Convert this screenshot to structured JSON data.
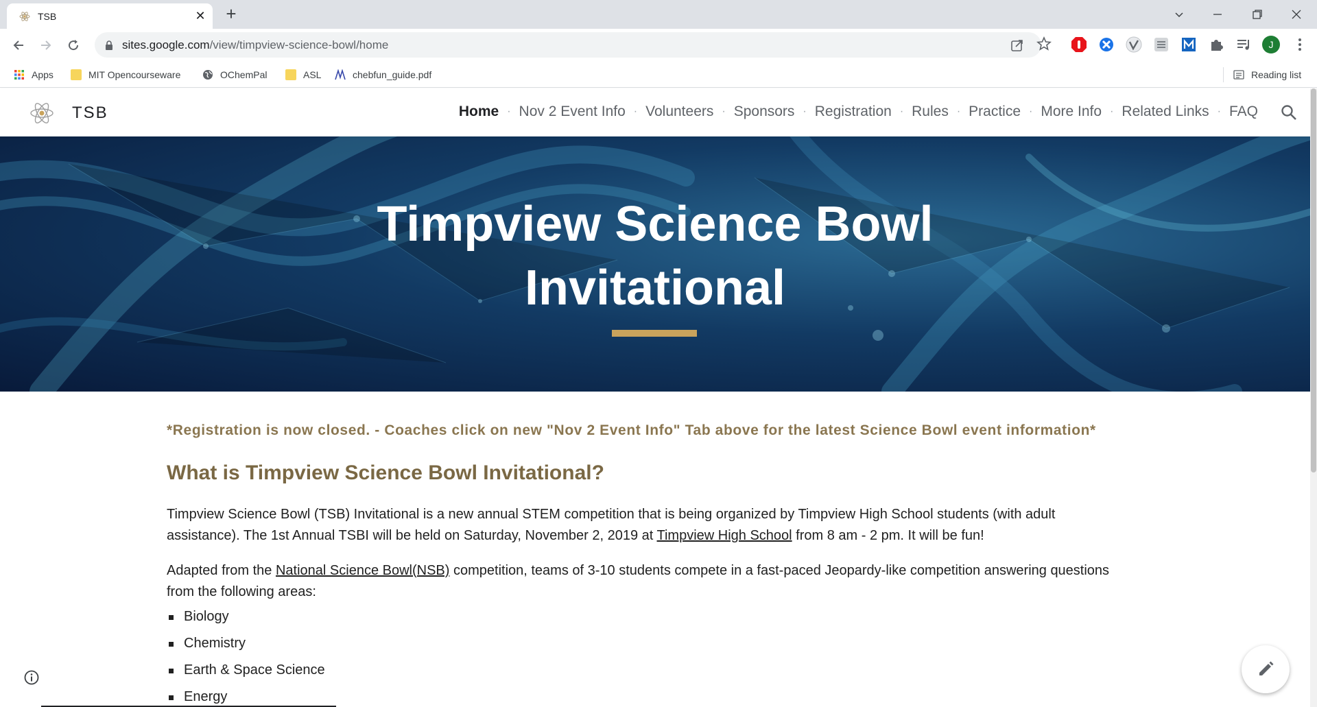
{
  "browser": {
    "tab_title": "TSB",
    "new_tab_symbol": "+",
    "close_symbol": "✕",
    "url_host": "sites.google.com",
    "url_path": "/view/timpview-science-bowl/home",
    "avatar_initial": "J",
    "reading_list_label": "Reading list",
    "bookmarks": [
      "Apps",
      "MIT Opencourseware",
      "OChemPal",
      "ASL",
      "chebfun_guide.pdf"
    ]
  },
  "site": {
    "name": "TSB",
    "nav": [
      "Home",
      "Nov 2 Event Info",
      "Volunteers",
      "Sponsors",
      "Registration",
      "Rules",
      "Practice",
      "More Info",
      "Related Links",
      "FAQ"
    ],
    "nav_separator": "·",
    "hero_title_line1": "Timpview Science Bowl",
    "hero_title_line2": "Invitational",
    "notice": "*Registration is now closed. - Coaches click on new \"Nov 2 Event Info\" Tab above for the latest Science Bowl event information*",
    "heading": "What is Timpview Science Bowl Invitational?",
    "p1_part1": "Timpview Science Bowl (TSB) Invitational is a new annual STEM competition that is being organized by Timpview High School students (with adult assistance). The 1st Annual TSBI will be held on Saturday, November 2, 2019 at ",
    "p1_link": "Timpview High School",
    "p1_part2": " from 8 am - 2 pm. It will be fun!",
    "p2_part1": "Adapted from the ",
    "p2_link": "National Science Bowl(NSB)",
    "p2_part2": " competition, teams of 3-10 students compete in a fast-paced Jeopardy-like competition answering questions from the following areas:",
    "areas": [
      "Biology",
      "Chemistry",
      "Earth & Space Science",
      "Energy"
    ]
  },
  "colors": {
    "accent_gold": "#c9a35c",
    "heading_brown": "#7a6844",
    "notice_brown": "#8a7650"
  },
  "icons": [
    "back-icon",
    "forward-icon",
    "reload-icon",
    "lock-icon",
    "share-icon",
    "star-icon",
    "extensions-icon",
    "media-icon",
    "menu-icon",
    "search-icon",
    "info-icon",
    "edit-icon"
  ]
}
